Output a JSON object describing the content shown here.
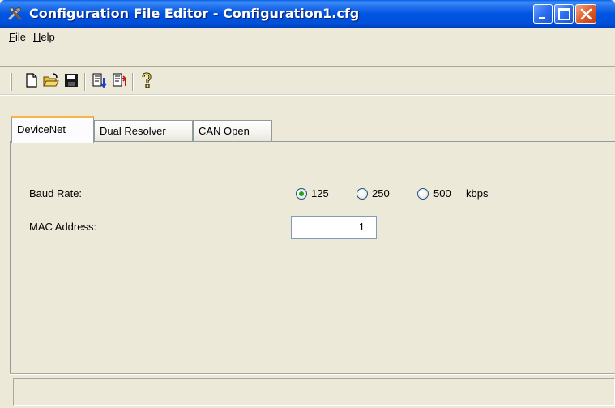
{
  "window": {
    "title": "Configuration File Editor - Configuration1.cfg",
    "accent_color": "#0054e3",
    "close_color": "#e0602c"
  },
  "menu": {
    "file_mnemonic": "F",
    "file_rest": "ile",
    "help_mnemonic": "H",
    "help_rest": "elp"
  },
  "toolbar": {
    "buttons": [
      "new-file-icon",
      "open-folder-icon",
      "save-disk-icon",
      "import-icon",
      "export-icon",
      "help-icon"
    ]
  },
  "tabs": [
    {
      "label": "DeviceNet",
      "active": true
    },
    {
      "label": "Dual Resolver",
      "active": false
    },
    {
      "label": "CAN Open",
      "active": false
    }
  ],
  "form": {
    "baud_rate_label": "Baud Rate:",
    "baud_options": [
      {
        "label": "125",
        "selected": true
      },
      {
        "label": "250",
        "selected": false
      },
      {
        "label": "500",
        "selected": false
      }
    ],
    "baud_unit": "kbps",
    "mac_address_label": "MAC Address:",
    "mac_address_value": "1"
  },
  "statusbar": {
    "text": ""
  }
}
